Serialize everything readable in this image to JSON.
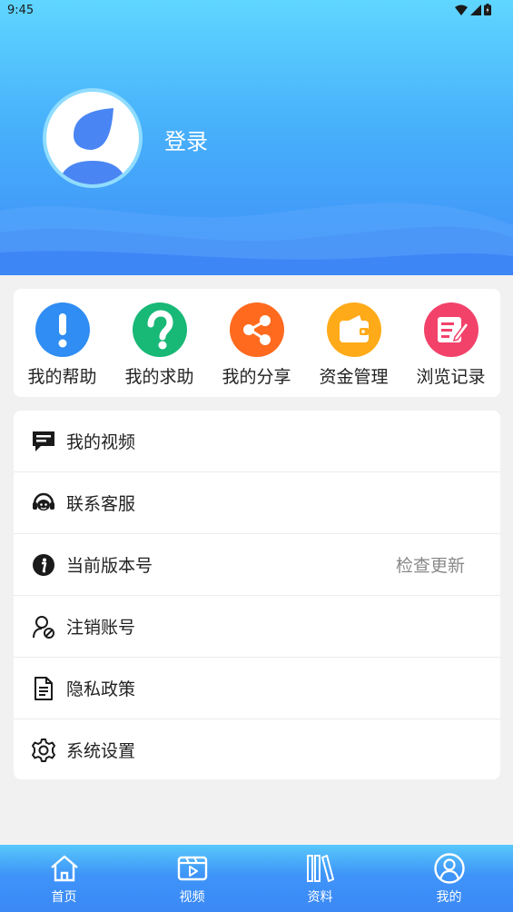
{
  "status_bar": {
    "time": "9:45"
  },
  "header": {
    "login_label": "登录"
  },
  "quick_actions": [
    {
      "label": "我的帮助",
      "icon": "exclamation-icon",
      "color": "#2f8df3"
    },
    {
      "label": "我的求助",
      "icon": "question-icon",
      "color": "#18b877"
    },
    {
      "label": "我的分享",
      "icon": "share-icon",
      "color": "#ff6a1f"
    },
    {
      "label": "资金管理",
      "icon": "wallet-icon",
      "color": "#ffaa18"
    },
    {
      "label": "浏览记录",
      "icon": "note-edit-icon",
      "color": "#f2426a"
    }
  ],
  "menu": [
    {
      "label": "我的视频",
      "icon": "message-icon"
    },
    {
      "label": "联系客服",
      "icon": "headset-icon"
    },
    {
      "label": "当前版本号",
      "icon": "info-icon",
      "right": "检查更新"
    },
    {
      "label": "注销账号",
      "icon": "user-cancel-icon"
    },
    {
      "label": "隐私政策",
      "icon": "document-icon"
    },
    {
      "label": "系统设置",
      "icon": "gear-icon"
    }
  ],
  "tabs": [
    {
      "label": "首页",
      "icon": "home-icon"
    },
    {
      "label": "视频",
      "icon": "video-icon"
    },
    {
      "label": "资料",
      "icon": "books-icon"
    },
    {
      "label": "我的",
      "icon": "profile-icon"
    }
  ]
}
